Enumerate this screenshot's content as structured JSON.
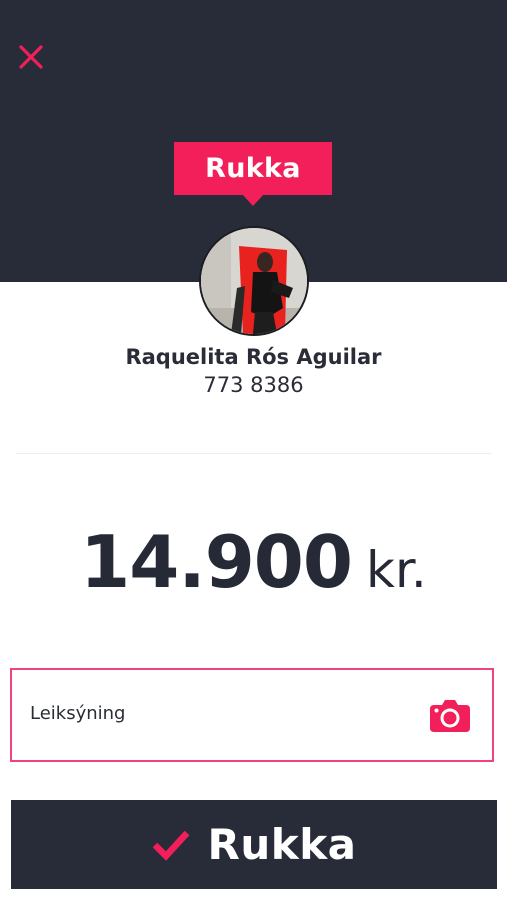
{
  "header": {
    "close_icon": "close-icon",
    "type_tag": "Rukka"
  },
  "recipient": {
    "name": "Raquelita Rós Aguilar",
    "phone": "773 8386"
  },
  "payment": {
    "amount": "14.900",
    "currency": "kr."
  },
  "description": {
    "placeholder": "Leiksýning",
    "camera_icon": "camera-icon"
  },
  "submit": {
    "label": "Rukka",
    "check_icon": "check-icon"
  },
  "colors": {
    "accent": "#f21f5b",
    "dark": "#282c38",
    "text": "#262a36"
  }
}
